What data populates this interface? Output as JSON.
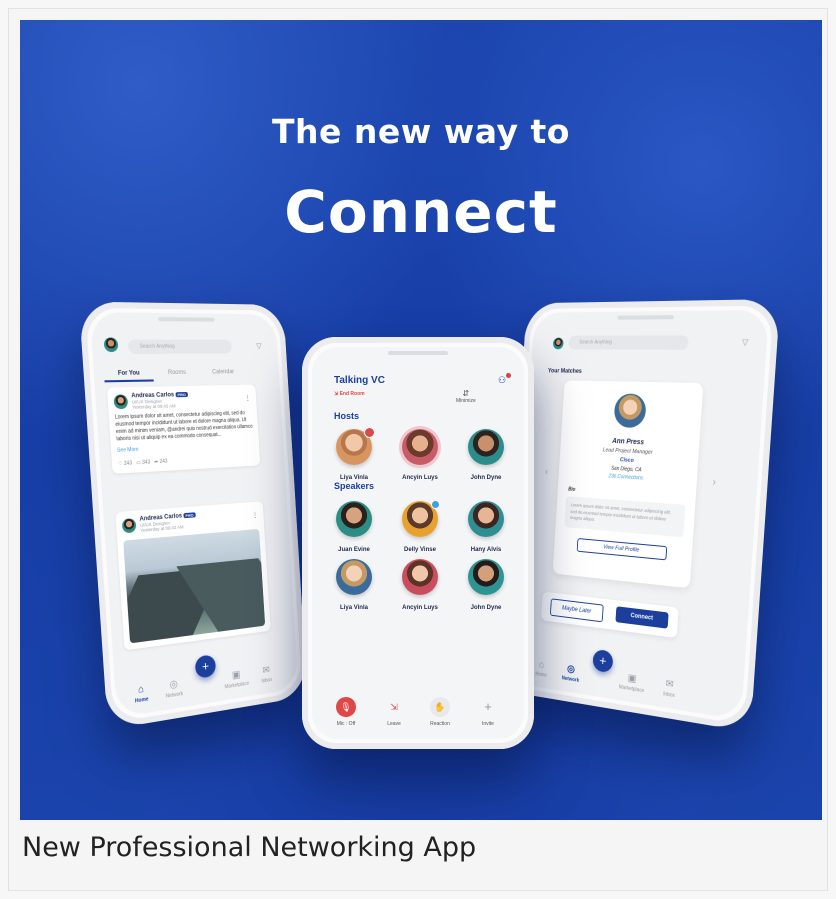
{
  "hero": {
    "tagline": "The new way to",
    "headline": "Connect"
  },
  "caption": "New Professional Networking App",
  "colors": {
    "brand": "#1c3f9e",
    "background": "#163ea6",
    "alert": "#e04848"
  },
  "left_phone": {
    "search_placeholder": "Search Anything",
    "tabs": [
      "For You",
      "Rooms",
      "Calendar"
    ],
    "posts": [
      {
        "author": "Andreas Carlos",
        "tag": "PRO",
        "role": "UI/UX Designer",
        "time": "Yesterday at 09:43 AM",
        "body": "Lorem ipsum dolor sit amet, consectetur adipiscing elit, sed do eiusmod tempor incididunt ut labore et dolore magna aliqua. Ut enim ad minim veniam, @andrei quis nostrud exercitation ullamco laboris nisi ut aliquip ex ea commodo consequat...",
        "see_more": "See More",
        "stats": [
          "243",
          "343",
          "243"
        ]
      },
      {
        "author": "Andreas Carlos",
        "tag": "PRO",
        "role": "UI/UX Designer",
        "time": "Yesterday at 09:43 AM"
      }
    ],
    "nav": [
      "Home",
      "Network",
      "Marketplace",
      "Inbox"
    ]
  },
  "center_phone": {
    "title": "Talking VC",
    "end_room": "End Room",
    "minimize": "Minimize",
    "hosts_label": "Hosts",
    "speakers_label": "Speakers",
    "hosts": [
      "Liya Vinla",
      "Ancyin Luys",
      "John Dyne"
    ],
    "speakers": [
      "Juan Evine",
      "Delly Vinse",
      "Hany Alvis",
      "Liya Vinla",
      "Ancyin Luys",
      "John Dyne"
    ],
    "controls": [
      "Mic : Off",
      "Leave",
      "Reaction",
      "Invite"
    ]
  },
  "right_phone": {
    "search_placeholder": "Search Anything",
    "matches_label": "Your Matches",
    "profile": {
      "name": "Ann Press",
      "role": "Lead Project Manager",
      "company": "Cisco",
      "location": "San Diego, CA",
      "connections": "236 Connections",
      "bio_label": "Bio",
      "bio": "Lorem ipsum dolor sit amet, consectetur adipiscing elit, sed do eiusmod tempor incididunt ut labore et dolore magna aliqua.",
      "view_profile": "View Full Profile"
    },
    "maybe_later": "Maybe Later",
    "connect": "Connect",
    "nav": [
      "Home",
      "Network",
      "Marketplace",
      "Inbox"
    ]
  }
}
